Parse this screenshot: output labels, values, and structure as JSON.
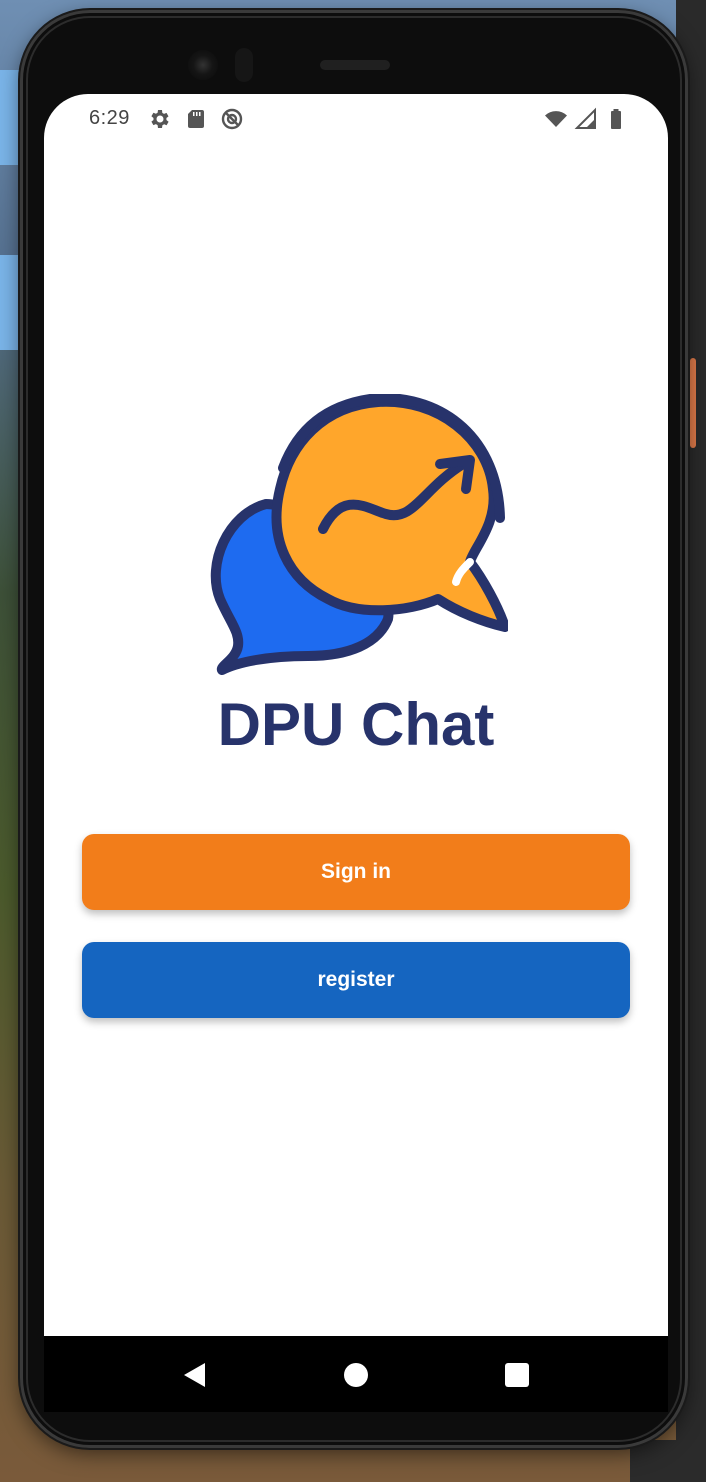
{
  "status_bar": {
    "time": "6:29",
    "left_icons": [
      "settings-icon",
      "sd-card-icon",
      "do-not-disturb-icon"
    ],
    "right_icons": [
      "wifi-icon",
      "signal-icon",
      "battery-icon"
    ]
  },
  "app": {
    "title": "DPU Chat",
    "logo": "chat-bubbles-logo",
    "colors": {
      "title": "#27336b",
      "bubble_orange": "#ffa62b",
      "bubble_blue": "#1e6bf0",
      "outline": "#27336b"
    }
  },
  "buttons": {
    "sign_in": {
      "label": "Sign in",
      "color": "#f27d1a"
    },
    "register": {
      "label": "register",
      "color": "#1565c0"
    }
  },
  "nav_bar": {
    "items": [
      "back-icon",
      "home-icon",
      "recents-icon"
    ]
  }
}
